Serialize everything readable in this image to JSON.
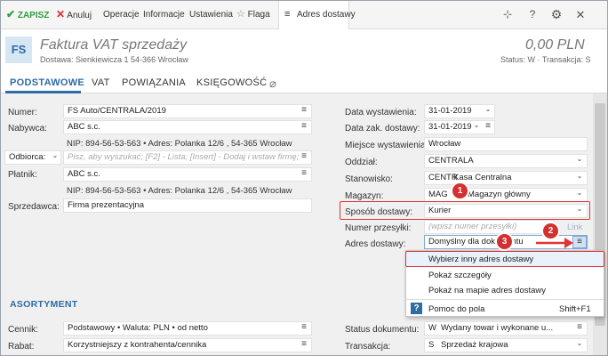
{
  "toolbar": {
    "save": "ZAPISZ",
    "cancel": "Anuluj",
    "operations": "Operacje",
    "information": "Informacje",
    "settings": "Ustawienia",
    "flag": "Flaga",
    "tab": "Adres dostawy"
  },
  "header": {
    "badge": "FS",
    "title": "Faktura VAT sprzedaży",
    "subtitle": "Dostawa: Sienkiewicza 1 54-366 Wrocław",
    "amount": "0,00 PLN",
    "status": "Status:  W  ·  Transakcja:  S"
  },
  "tabs": [
    "PODSTAWOWE",
    "VAT",
    "POWIĄZANIA",
    "KSIĘGOWOŚĆ"
  ],
  "left": {
    "numer_label": "Numer:",
    "numer_value": "FS Auto/CENTRALA/2019",
    "nabywca_label": "Nabywca:",
    "nabywca_value": "ABC s.c.",
    "nabywca_details": "NIP: 894-56-53-563  •  Adres: Polanka  12/6 , 54-365 Wrocław",
    "odbiorca_label": "Odbiorca:",
    "odbiorca_placeholder": "Pisz, aby wyszukać; [F2] - Lista; [Insert] - Dodaj i wstaw firmę;",
    "platnik_label": "Płatnik:",
    "platnik_value": "ABC s.c.",
    "platnik_details": "NIP: 894-56-53-563  •  Adres: Polanka  12/6 , 54-365 Wrocław",
    "sprzedawca_label": "Sprzedawca:",
    "sprzedawca_value": "Firma prezentacyjna"
  },
  "right": {
    "data_wyst_label": "Data wystawienia:",
    "data_wyst_value": "31-01-2019",
    "data_zak_label": "Data zak. dostawy:",
    "data_zak_value": "31-01-2019",
    "miejsce_label": "Miejsce wystawienia:",
    "miejsce_value": "Wrocław",
    "oddzial_label": "Oddział:",
    "oddzial_value": "CENTRALA",
    "stanowisko_label": "Stanowisko:",
    "stanowisko_code": "CENTR",
    "stanowisko_value": "Kasa Centralna",
    "magazyn_label": "Magazyn:",
    "magazyn_code": "MAG",
    "magazyn_value": "Magazyn główny",
    "sposob_label": "Sposób dostawy:",
    "sposob_value": "Kurier",
    "numer_przesylki_label": "Numer przesyłki:",
    "numer_przesylki_placeholder": "(wpisz numer przesyłki)",
    "link": "Link",
    "adres_label": "Adres dostawy:",
    "adres_value": "Domyślny dla dokumentu"
  },
  "popup": {
    "items": [
      "Wybierz inny adres dostawy",
      "Pokaż szczegóły",
      "Pokaż na mapie adres dostawy"
    ],
    "help": "Pomoc do pola",
    "shortcut": "Shift+F1"
  },
  "assortment": {
    "section": "ASORTYMENT",
    "cennik_label": "Cennik:",
    "cennik_value": "Podstawowy • Waluta: PLN • od netto",
    "rabat_label": "Rabat:",
    "rabat_value": "Korzystniejszy z kontrahenta/cennika",
    "status_label": "Status dokumentu:",
    "status_code": "W",
    "status_value": "Wydany towar i wykonane u...",
    "transakcja_label": "Transakcja:",
    "transakcja_code": "S",
    "transakcja_value": "Sprzedaż krajowa"
  },
  "annotations": [
    "1",
    "2",
    "3"
  ],
  "colors": {
    "accent": "#2e6ca4",
    "save_green": "#2e9e3e",
    "cancel_red": "#d43030",
    "annotation_red": "#e03535"
  }
}
